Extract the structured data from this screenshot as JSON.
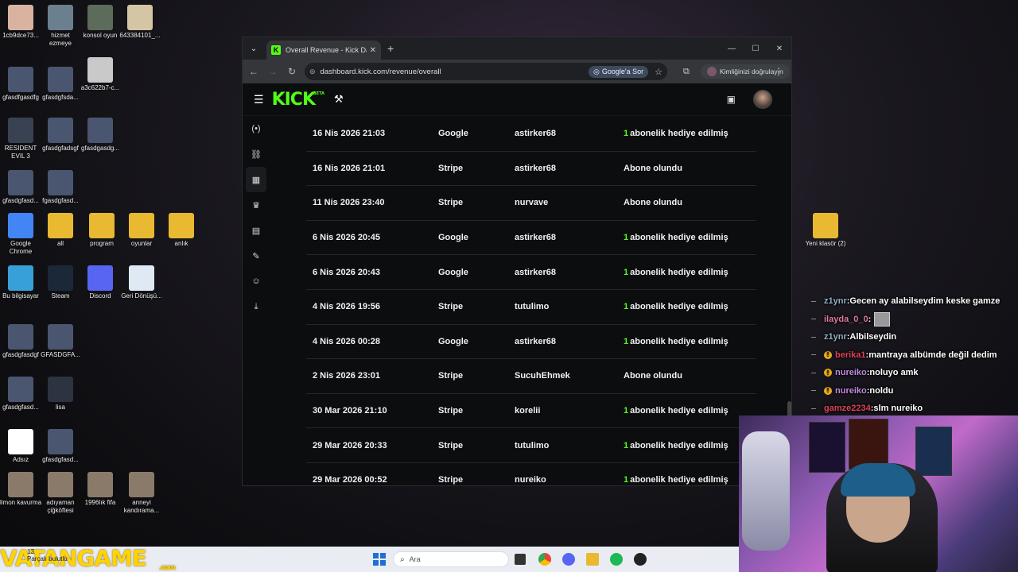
{
  "desktop": {
    "icons": [
      {
        "label": "1cb9dce73...",
        "color": "#d9b3a0"
      },
      {
        "label": "hizmet ezmeye",
        "color": "#6b7f8f"
      },
      {
        "label": "konsol oyun",
        "color": "#5d6b5a"
      },
      {
        "label": "643384101_...",
        "color": "#d4c5a4"
      },
      {
        "label": "gfasdfgasdfg",
        "color": "#4a5670"
      },
      {
        "label": "gfasdgfsda...",
        "color": "#4a5670"
      },
      {
        "label": "a3c622b7-c...",
        "color": "#c9c9c9"
      },
      {
        "label": "RESIDENT EVIL 3",
        "color": "#394250"
      },
      {
        "label": "gfasdgfadsgf",
        "color": "#4a5670"
      },
      {
        "label": "gfasdgasdg...",
        "color": "#4a5670"
      },
      {
        "label": "gfasdgfasd...",
        "color": "#4a5670"
      },
      {
        "label": "fgasdgfasd...",
        "color": "#4a5670"
      },
      {
        "label": "Google Chrome",
        "color": "#4285f4"
      },
      {
        "label": "all",
        "color": "#e8b931"
      },
      {
        "label": "program",
        "color": "#e8b931"
      },
      {
        "label": "oyunlar",
        "color": "#e8b931"
      },
      {
        "label": "anlık",
        "color": "#e8b931"
      },
      {
        "label": "Bu bilgisayar",
        "color": "#38a0d8"
      },
      {
        "label": "Steam",
        "color": "#1b2838"
      },
      {
        "label": "Discord",
        "color": "#5865f2"
      },
      {
        "label": "Geri Dönüşü...",
        "color": "#dfe9f3"
      },
      {
        "label": "gfasdgfasdgf",
        "color": "#4a5670"
      },
      {
        "label": "GFASDGFA...",
        "color": "#4a5670"
      },
      {
        "label": "gfasdgfasd...",
        "color": "#4a5670"
      },
      {
        "label": "lisa",
        "color": "#2d3340"
      },
      {
        "label": "Adsız",
        "color": "#ffffff"
      },
      {
        "label": "gfasdgfasd...",
        "color": "#4a5670"
      },
      {
        "label": "limon kavurma",
        "color": "#8a7a6a"
      },
      {
        "label": "adıyaman çiğköftesi",
        "color": "#8a7a6a"
      },
      {
        "label": "1996lık fifa",
        "color": "#8a7a6a"
      },
      {
        "label": "anneyi kandırama...",
        "color": "#8a7a6a"
      },
      {
        "label": "Yeni klasör (2)",
        "color": "#e8b931"
      }
    ]
  },
  "browser": {
    "tab_title": "Overall Revenue - Kick Dashboard",
    "tab_favicon": "K",
    "url": "dashboard.kick.com/revenue/overall",
    "google_sor": "Google'a Sor",
    "verify": "Kimliğinizi doğrulayın"
  },
  "kick": {
    "logo": "KICK",
    "logo_tag": "BETA",
    "brand_color": "#53fc18"
  },
  "revenue_rows": [
    {
      "date": "16 Nis 2026 21:03",
      "provider": "Google",
      "user": "astirker68",
      "num": "1",
      "type": "abonelik hediye edilmiş"
    },
    {
      "date": "16 Nis 2026 21:01",
      "provider": "Stripe",
      "user": "astirker68",
      "num": "",
      "type": "Abone olundu"
    },
    {
      "date": "11 Nis 2026 23:40",
      "provider": "Stripe",
      "user": "nurvave",
      "num": "",
      "type": "Abone olundu"
    },
    {
      "date": "6 Nis 2026 20:45",
      "provider": "Google",
      "user": "astirker68",
      "num": "1",
      "type": "abonelik hediye edilmiş"
    },
    {
      "date": "6 Nis 2026 20:43",
      "provider": "Google",
      "user": "astirker68",
      "num": "1",
      "type": "abonelik hediye edilmiş"
    },
    {
      "date": "4 Nis 2026 19:56",
      "provider": "Stripe",
      "user": "tutulimo",
      "num": "1",
      "type": "abonelik hediye edilmiş"
    },
    {
      "date": "4 Nis 2026 00:28",
      "provider": "Google",
      "user": "astirker68",
      "num": "1",
      "type": "abonelik hediye edilmiş"
    },
    {
      "date": "2 Nis 2026 23:01",
      "provider": "Stripe",
      "user": "SucuhEhmek",
      "num": "",
      "type": "Abone olundu"
    },
    {
      "date": "30 Mar 2026 21:10",
      "provider": "Stripe",
      "user": "korelii",
      "num": "1",
      "type": "abonelik hediye edilmiş"
    },
    {
      "date": "29 Mar 2026 20:33",
      "provider": "Stripe",
      "user": "tutulimo",
      "num": "1",
      "type": "abonelik hediye edilmiş"
    },
    {
      "date": "29 Mar 2026 00:52",
      "provider": "Stripe",
      "user": "nureiko",
      "num": "1",
      "type": "abonelik hediye edilmiş"
    }
  ],
  "chat": [
    {
      "user": "z1ynr",
      "color": "#8fb0c4",
      "badge": false,
      "msg": "Gecen ay alabilseydim keske gamze",
      "emote": false
    },
    {
      "user": "ilayda_0_0",
      "color": "#e07aa0",
      "badge": false,
      "msg": "",
      "emote": true
    },
    {
      "user": "z1ynr",
      "color": "#8fb0c4",
      "badge": false,
      "msg": "Albilseydin",
      "emote": false
    },
    {
      "user": "berika1",
      "color": "#e0405a",
      "badge": true,
      "msg": "mantraya albümde değil dedim",
      "emote": false
    },
    {
      "user": "nureiko",
      "color": "#c28be0",
      "badge": true,
      "msg": "noluyo amk",
      "emote": false
    },
    {
      "user": "nureiko",
      "color": "#c28be0",
      "badge": true,
      "msg": "noldu",
      "emote": false
    },
    {
      "user": "gamze2234",
      "color": "#e0405a",
      "badge": false,
      "msg": "slm nureiko",
      "emote": false
    }
  ],
  "taskbar": {
    "search_placeholder": "Ara",
    "notif": "13",
    "notif_text": "Parçalı bulutlu"
  },
  "overlay": {
    "brand": "VATANGAME",
    "domain": ".com"
  }
}
